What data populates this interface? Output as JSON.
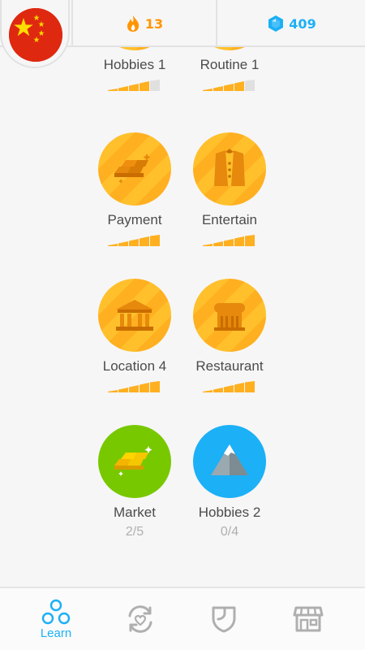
{
  "header": {
    "flag_icon": "china-flag-icon",
    "streak": {
      "icon": "flame-icon",
      "value": "13",
      "color": "#ff9600"
    },
    "gems": {
      "icon": "gem-icon",
      "value": "409",
      "color": "#1cb0f6"
    }
  },
  "skills": [
    {
      "name": "Hobbies 1",
      "icon": "hobbies-icon",
      "level_fraction": 0.8,
      "state": "gold"
    },
    {
      "name": "Routine 1",
      "icon": "routine-icon",
      "level_fraction": 0.8,
      "state": "gold"
    },
    {
      "name": "Payment",
      "icon": "gold-bars-icon",
      "level_fraction": 1.0,
      "state": "gold"
    },
    {
      "name": "Entertain",
      "icon": "tuxedo-icon",
      "level_fraction": 1.0,
      "state": "gold"
    },
    {
      "name": "Location 4",
      "icon": "bank-building-icon",
      "level_fraction": 1.0,
      "state": "gold"
    },
    {
      "name": "Restaurant",
      "icon": "restaurant-building-icon",
      "level_fraction": 1.0,
      "state": "gold"
    },
    {
      "name": "Market",
      "icon": "gold-bars-icon",
      "progress": "2/5",
      "state": "green"
    },
    {
      "name": "Hobbies 2",
      "icon": "mountain-icon",
      "progress": "0/4",
      "state": "blue"
    }
  ],
  "nav": [
    {
      "label": "Learn",
      "icon": "learn-icon",
      "active": true
    },
    {
      "label": "",
      "icon": "practice-heart-icon",
      "active": false
    },
    {
      "label": "",
      "icon": "shield-icon",
      "active": false
    },
    {
      "label": "",
      "icon": "shop-icon",
      "active": false
    }
  ],
  "colors": {
    "accent": "#1cb0f6",
    "gold": "#ffb020",
    "green": "#78c800",
    "text": "#4b4b4b",
    "muted": "#afafaf"
  }
}
